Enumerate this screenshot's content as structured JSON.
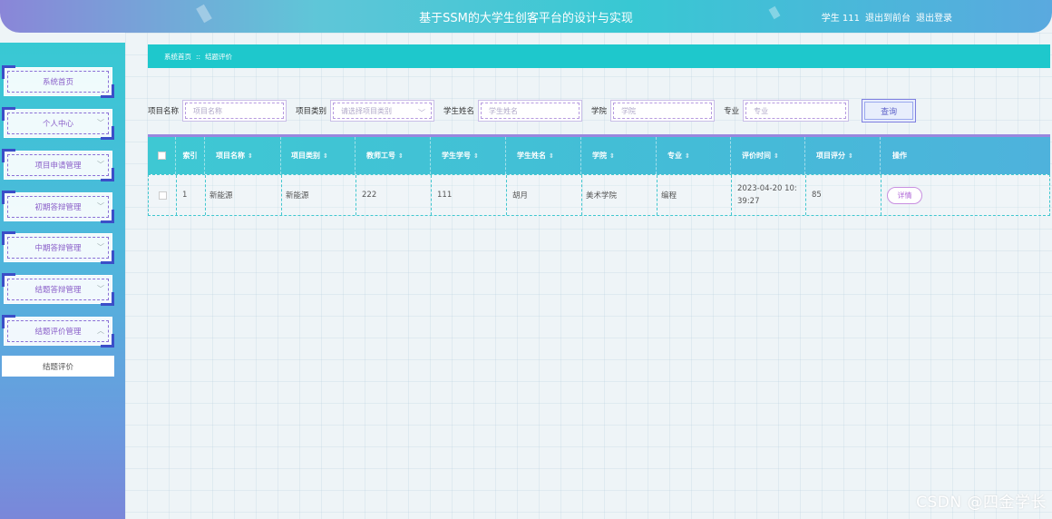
{
  "header": {
    "title": "基于SSM的大学生创客平台的设计与实现",
    "user_label": "学生 111",
    "back_link": "退出到前台",
    "logout_link": "退出登录"
  },
  "sidebar": {
    "items": [
      {
        "label": "系统首页",
        "has_chevron": false
      },
      {
        "label": "个人中心",
        "has_chevron": true
      },
      {
        "label": "项目申请管理",
        "has_chevron": true
      },
      {
        "label": "初期答辩管理",
        "has_chevron": true
      },
      {
        "label": "中期答辩管理",
        "has_chevron": true
      },
      {
        "label": "结题答辩管理",
        "has_chevron": true
      },
      {
        "label": "结题评价管理",
        "has_chevron": true,
        "expanded": true
      }
    ],
    "submenu": {
      "label": "结题评价"
    }
  },
  "breadcrumb": {
    "home": "系统首页",
    "sep": "::",
    "current": "结题评价"
  },
  "search": {
    "project_name_label": "项目名称",
    "project_name_placeholder": "项目名称",
    "project_type_label": "项目类别",
    "project_type_placeholder": "请选择项目类别",
    "student_name_label": "学生姓名",
    "student_name_placeholder": "学生姓名",
    "college_label": "学院",
    "college_placeholder": "学院",
    "major_label": "专业",
    "major_placeholder": "专业",
    "query_button": "查询"
  },
  "table": {
    "headers": {
      "index": "索引",
      "project_name": "项目名称",
      "project_type": "项目类别",
      "teacher_id": "教师工号",
      "student_id": "学生学号",
      "student_name": "学生姓名",
      "college": "学院",
      "major": "专业",
      "eval_time": "评价时间",
      "score": "项目评分",
      "action": "操作"
    },
    "rows": [
      {
        "index": "1",
        "project_name": "新能源",
        "project_type": "新能源",
        "teacher_id": "222",
        "student_id": "111",
        "student_name": "胡月",
        "college": "美术学院",
        "major": "编程",
        "eval_time": "2023-04-20 10:39:27",
        "score": "85",
        "action": "详情"
      }
    ]
  },
  "watermark": "CSDN @四金学长"
}
